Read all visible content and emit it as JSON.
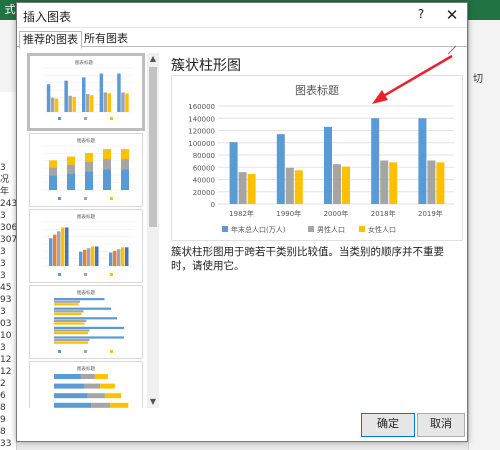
{
  "dialog": {
    "title": "插入图表",
    "help_glyph": "?",
    "close_glyph": "✕",
    "tabs": [
      {
        "label": "推荐的图表"
      },
      {
        "label": "所有图表"
      }
    ],
    "ok_label": "确定",
    "cancel_label": "取消"
  },
  "preview": {
    "chart_name": "簇状柱形图",
    "description": "簇状柱形图用于跨若干类别比较值。当类别的顺序并不重要时，请使用它。"
  },
  "thumbnails": {
    "title": "图表标题",
    "items": [
      {
        "kind": "clustered-column"
      },
      {
        "kind": "stacked-column"
      },
      {
        "kind": "clustered-column-by-series"
      },
      {
        "kind": "clustered-bar"
      },
      {
        "kind": "stacked-bar"
      }
    ]
  },
  "background": {
    "left_cells": [
      "3",
      "况",
      "年",
      "243",
      "3",
      "306",
      "307",
      "3",
      "3",
      "3",
      "45",
      "93",
      "3",
      "03",
      "10",
      "3",
      "12",
      "12",
      "2",
      "6",
      "8",
      "9",
      "8",
      "33"
    ],
    "right_cells": [
      "切"
    ]
  },
  "colors": {
    "blue": "#5b9bd5",
    "gray": "#a5a5a5",
    "gold": "#ffc000",
    "arrow": "#e8212e"
  },
  "chart_data": {
    "type": "bar",
    "title": "图表标题",
    "categories": [
      "1982年",
      "1990年",
      "2000年",
      "2018年",
      "2019年"
    ],
    "series": [
      {
        "name": "年末总人口(万人)",
        "values": [
          101000,
          114000,
          126000,
          140000,
          140000
        ]
      },
      {
        "name": "男性人口",
        "values": [
          52000,
          59000,
          65000,
          71000,
          71000
        ]
      },
      {
        "name": "女性人口",
        "values": [
          49000,
          55000,
          61000,
          68000,
          68000
        ]
      }
    ],
    "ylim": [
      0,
      160000
    ],
    "yticks": [
      "0",
      "20000",
      "40000",
      "60000",
      "80000",
      "100000",
      "120000",
      "140000",
      "160000"
    ],
    "grid": true,
    "legend": "bottom"
  }
}
